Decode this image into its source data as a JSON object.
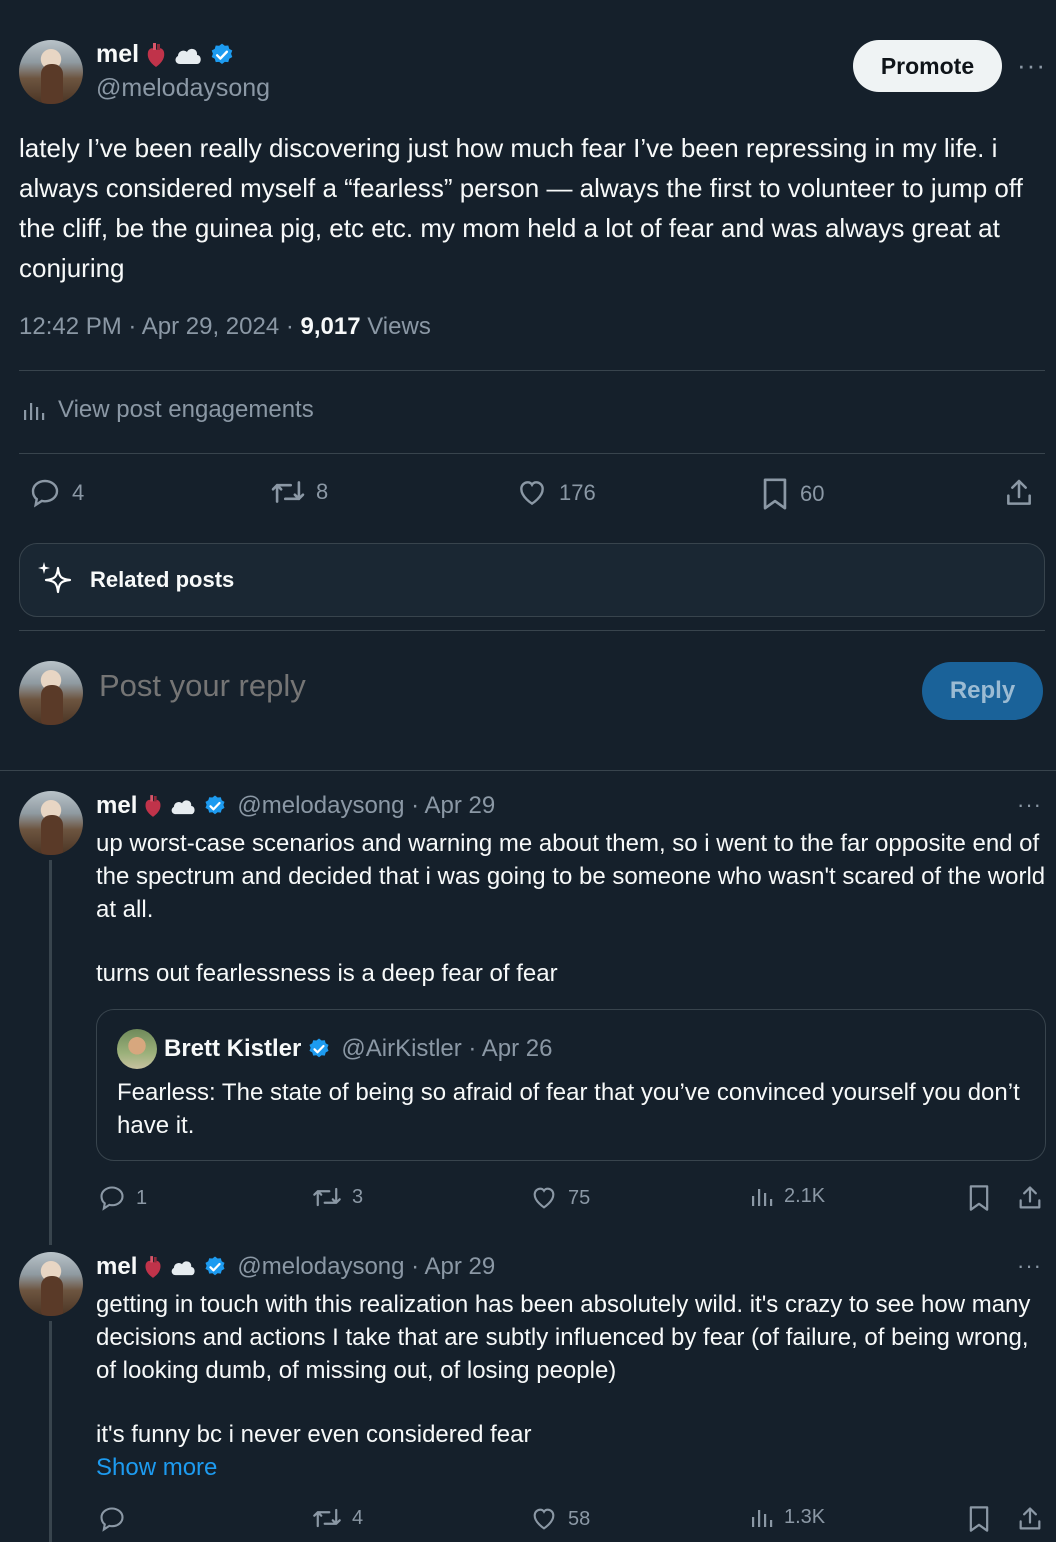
{
  "post": {
    "author_name": "mel",
    "author_handle": "@melodaysong",
    "promote_label": "Promote",
    "more_label": "···",
    "text": "lately I’ve been really discovering just how much fear I’ve been repressing in my life. i always considered myself a “fearless” person — always the first to volunteer to jump off the cliff, be the guinea pig, etc etc. my mom held a lot of fear and was always great at conjuring",
    "time": "12:42 PM · Apr 29, 2024 · ",
    "views_count": "9,017",
    "views_label": " Views",
    "engagements_label": "View post engagements",
    "actions": {
      "replies": "4",
      "reposts": "8",
      "likes": "176",
      "bookmarks": "60"
    }
  },
  "related": {
    "label": "Related posts"
  },
  "reply_box": {
    "placeholder": "Post your reply",
    "button_label": "Reply"
  },
  "replies": [
    {
      "name": "mel",
      "meta": "@melodaysong · Apr 29",
      "text_p1": "up worst-case scenarios and warning me about them, so i went to the far opposite end of the spectrum and decided that i was going to be someone who wasn't scared of the world at all.",
      "text_p2": "turns out fearlessness is a deep fear of fear",
      "quote": {
        "name": "Brett Kistler",
        "meta": "@AirKistler · Apr 26",
        "text": "Fearless: The state of being so afraid of fear that you’ve convinced yourself you don’t have it."
      },
      "actions": {
        "replies": "1",
        "reposts": "3",
        "likes": "75",
        "views": "2.1K"
      }
    },
    {
      "name": "mel",
      "meta": "@melodaysong · Apr 29",
      "text_p1": "getting in touch with this realization has been absolutely wild. it's crazy to see how many decisions and actions I take that are subtly influenced by fear (of failure, of being wrong, of looking dumb, of missing out, of losing people)",
      "text_p2": "it's funny bc i never even considered fear",
      "show_more": "Show more",
      "actions": {
        "replies": "",
        "reposts": "4",
        "likes": "58",
        "views": "1.3K"
      }
    }
  ],
  "colors": {
    "background": "#15202b",
    "accent": "#1d9bf0",
    "muted": "#8b98a5",
    "divider": "#38444d"
  }
}
